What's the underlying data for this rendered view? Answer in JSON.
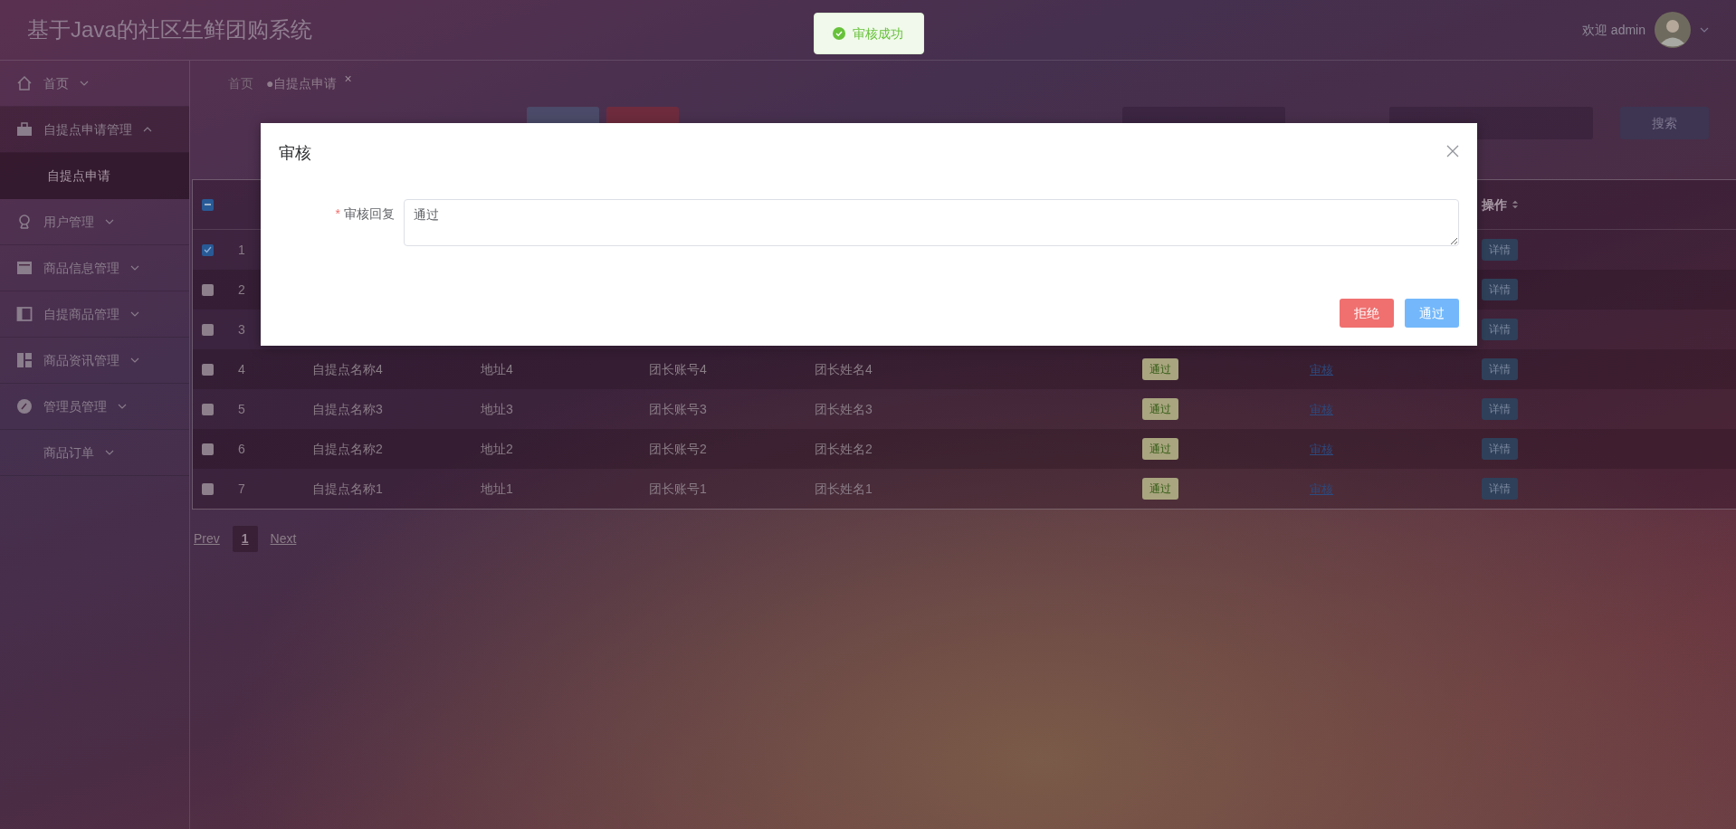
{
  "header": {
    "title": "基于Java的社区生鲜团购系统",
    "welcome": "欢迎 admin"
  },
  "toast": {
    "kind": "success",
    "text": "审核成功"
  },
  "sidebar": {
    "items": [
      {
        "label": "首页",
        "expanded": false
      },
      {
        "label": "自提点申请管理",
        "expanded": true,
        "children": [
          {
            "label": "自提点申请",
            "selected": true
          }
        ]
      },
      {
        "label": "用户管理",
        "expanded": false
      },
      {
        "label": "商品信息管理",
        "expanded": false
      },
      {
        "label": "自提商品管理",
        "expanded": false
      },
      {
        "label": "商品资讯管理",
        "expanded": false
      },
      {
        "label": "管理员管理",
        "expanded": false
      },
      {
        "label": "商品订单",
        "expanded": false
      }
    ]
  },
  "breadcrumb": [
    {
      "label": "首页",
      "selected": false
    },
    {
      "label": "●自提点申请",
      "selected": true,
      "close": "×"
    }
  ],
  "toolbar": {
    "search_button": "搜索"
  },
  "table": {
    "select_all": {
      "indeterminate": true
    },
    "action_header": {
      "label": "操作",
      "sortable": true
    },
    "rows": [
      {
        "selected": true,
        "index": "1",
        "detail": "详情"
      },
      {
        "selected": false,
        "index": "2",
        "detail": "详情"
      },
      {
        "selected": false,
        "index": "3",
        "detail": "详情"
      },
      {
        "selected": false,
        "index": "4",
        "name": "自提点名称4",
        "address": "地址4",
        "account": "团长账号4",
        "leader": "团长姓名4",
        "status": "通过",
        "review": "审核",
        "detail": "详情"
      },
      {
        "selected": false,
        "index": "5",
        "name": "自提点名称3",
        "address": "地址3",
        "account": "团长账号3",
        "leader": "团长姓名3",
        "status": "通过",
        "review": "审核",
        "detail": "详情"
      },
      {
        "selected": false,
        "index": "6",
        "name": "自提点名称2",
        "address": "地址2",
        "account": "团长账号2",
        "leader": "团长姓名2",
        "status": "通过",
        "review": "审核",
        "detail": "详情"
      },
      {
        "selected": false,
        "index": "7",
        "name": "自提点名称1",
        "address": "地址1",
        "account": "团长账号1",
        "leader": "团长姓名1",
        "status": "通过",
        "review": "审核",
        "detail": "详情"
      }
    ]
  },
  "pagination": {
    "prev": "Prev",
    "pages": [
      {
        "label": "1",
        "selected": true
      }
    ],
    "next": "Next"
  },
  "dialog": {
    "title": "审核",
    "field": {
      "label": "审核回复",
      "required_mark": "*",
      "value": "通过"
    },
    "buttons": [
      {
        "label": "拒绝",
        "kind": "danger"
      },
      {
        "label": "通过",
        "kind": "primary"
      }
    ]
  }
}
